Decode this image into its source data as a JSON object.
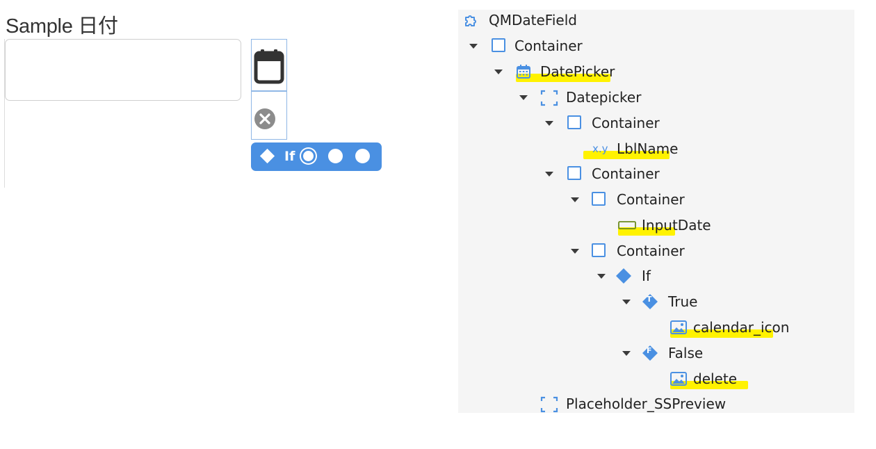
{
  "preview": {
    "title": "Sample 日付",
    "if_widget_label": "If",
    "input_value": ""
  },
  "tree": {
    "root": "QMDateField",
    "container_1": "Container",
    "datepicker_block": "DatePicker",
    "datepicker_placeholder": "Datepicker",
    "container_2": "Container",
    "lbl_name": "LblName",
    "container_3": "Container",
    "container_4": "Container",
    "input_date": "InputDate",
    "container_5": "Container",
    "if_node": "If",
    "true_branch": "True",
    "calendar_icon": "calendar_icon",
    "false_branch": "False",
    "delete_image": "delete",
    "placeholder_sspreview": "Placeholder_SSPreview",
    "expression_icon_text": "x.y",
    "true_badge": "T",
    "false_badge": "F"
  },
  "colors": {
    "accent": "#4a90e2",
    "highlight": "#fff200",
    "panel_bg": "#f5f5f5"
  }
}
